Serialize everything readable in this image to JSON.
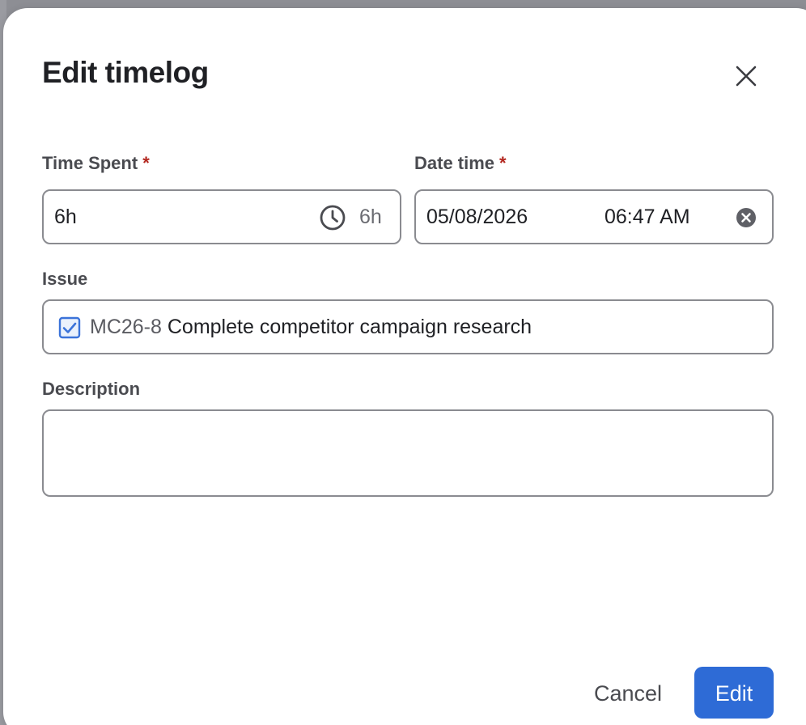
{
  "dialog": {
    "title": "Edit timelog"
  },
  "form": {
    "time_spent": {
      "label": "Time Spent",
      "required_mark": "*",
      "value": "6h",
      "suffix": "6h",
      "icon": "clock-icon"
    },
    "date_time": {
      "label": "Date time",
      "required_mark": "*",
      "date": "05/08/2026",
      "time": "06:47 AM",
      "icon": "clear-circle-icon"
    },
    "issue": {
      "label": "Issue",
      "key": "MC26-8",
      "summary": "Complete competitor campaign research",
      "icon": "checkbox-checked-icon"
    },
    "description": {
      "label": "Description",
      "value": ""
    }
  },
  "actions": {
    "cancel_label": "Cancel",
    "edit_label": "Edit"
  },
  "colors": {
    "primary": "#2e6bd6",
    "required": "#b3261e",
    "issue_icon": "#3b73d9"
  }
}
